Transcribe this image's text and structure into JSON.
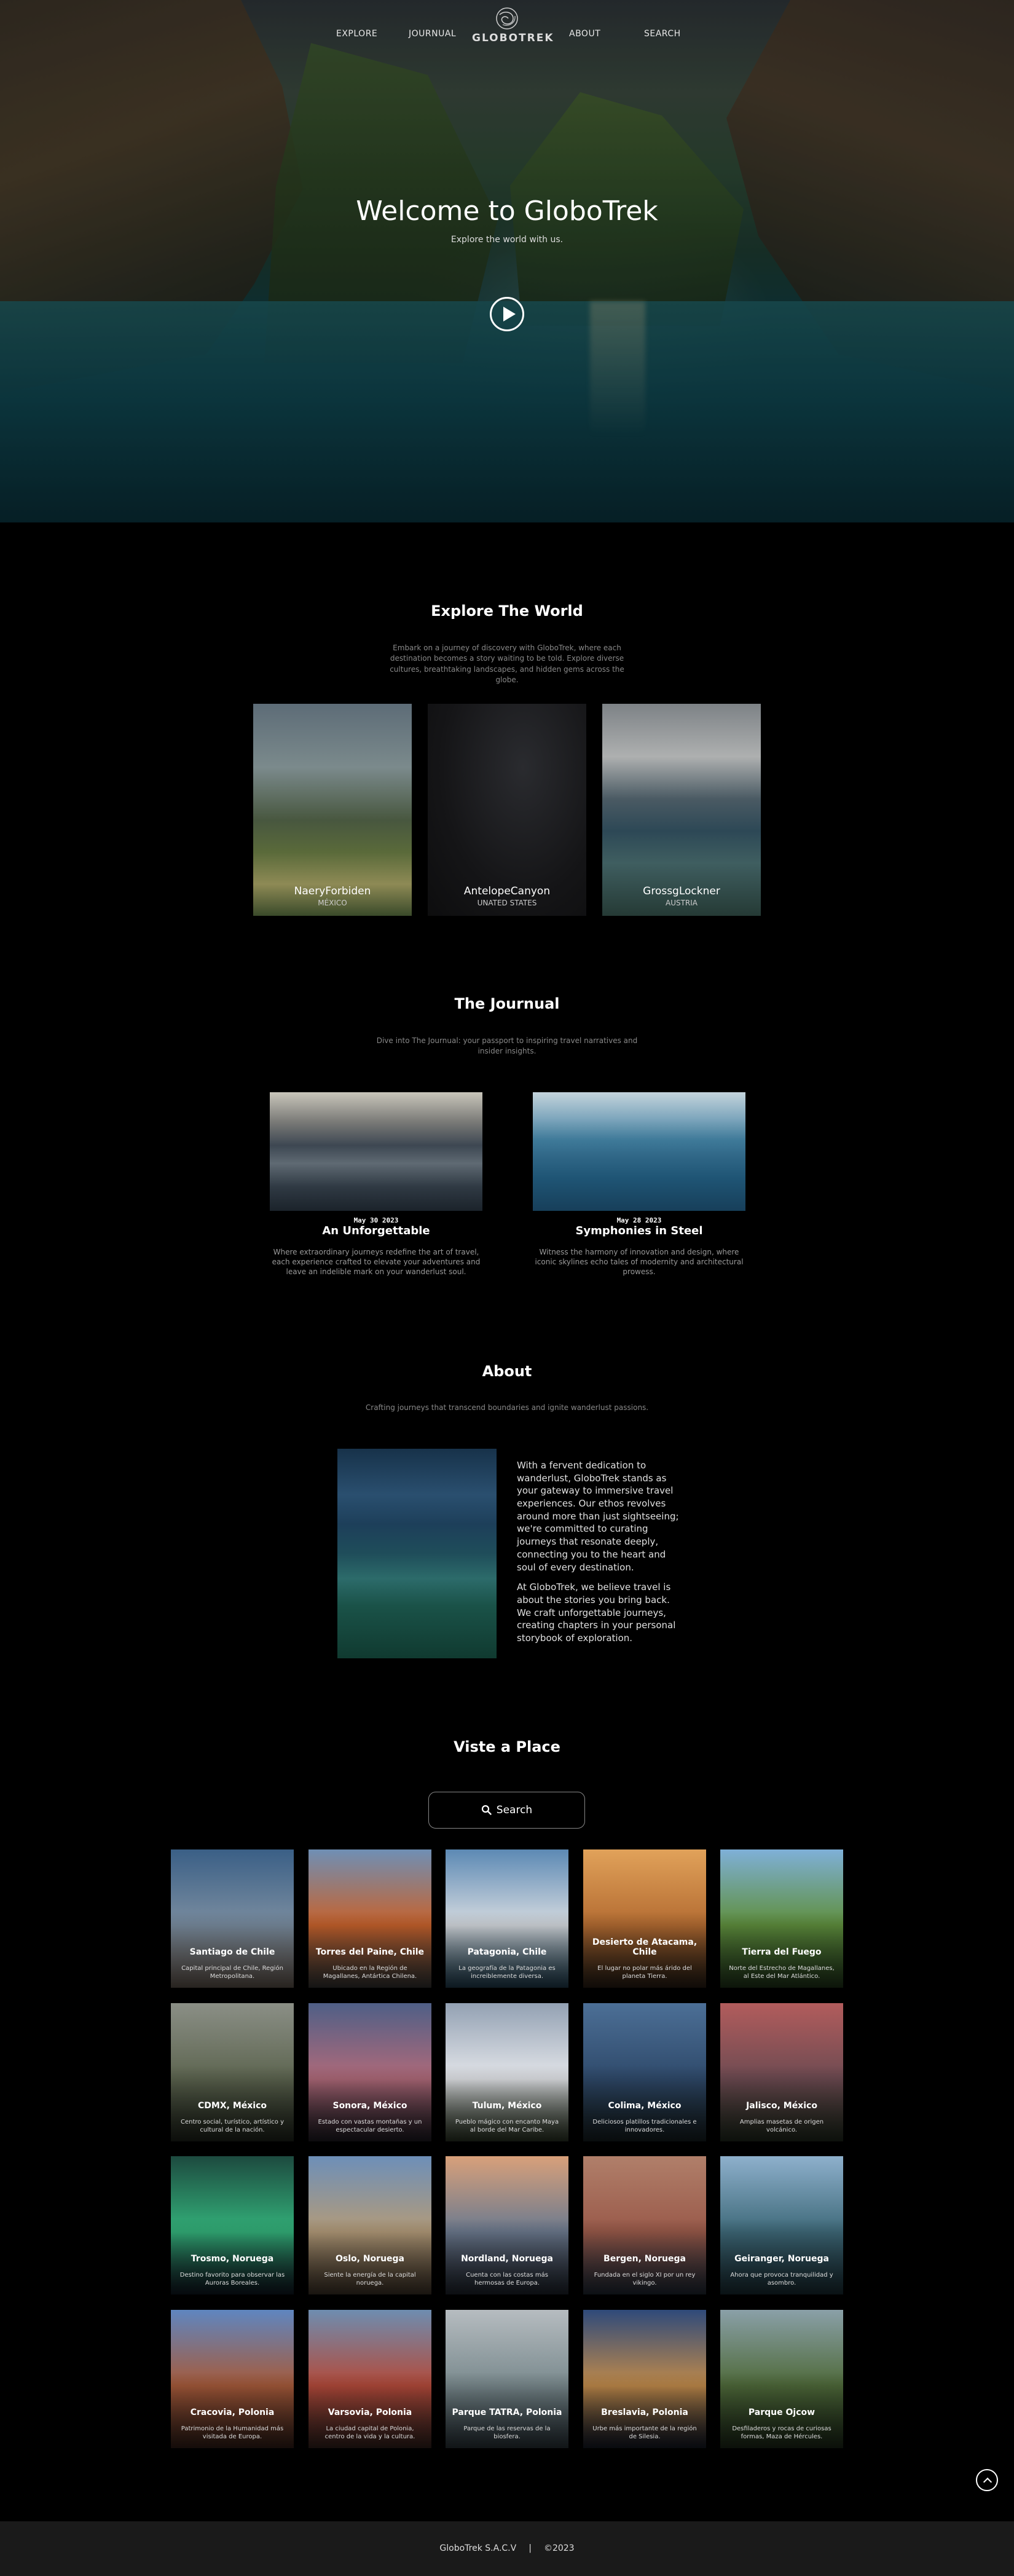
{
  "nav": {
    "links": [
      "EXPLORE",
      "JOURNUAL",
      "ABOUT",
      "SEARCH"
    ],
    "logo_text": "GLOBOTREK"
  },
  "hero": {
    "title": "Welcome to GloboTrek",
    "subtitle": "Explore the world with us."
  },
  "explore": {
    "title": "Explore The World",
    "description": "Embark on a journey of discovery with GloboTrek, where each destination becomes a story waiting to be told. Explore diverse cultures, breathtaking landscapes, and hidden gems across the globe.",
    "destinations": [
      {
        "name": "NaeryForbiden",
        "country": "MÉXICO"
      },
      {
        "name": "AntelopeCanyon",
        "country": "UNATED STATES"
      },
      {
        "name": "GrossgLockner",
        "country": "AUSTRIA"
      }
    ]
  },
  "journal": {
    "title": "The Journual",
    "description": "Dive into The Journual: your passport to inspiring travel narratives and insider insights.",
    "entries": [
      {
        "date": "May 30 2023",
        "title": "An Unforgettable",
        "text": "Where extraordinary journeys redefine the art of travel, each experience crafted to elevate your adventures and leave an indelible mark on your wanderlust soul."
      },
      {
        "date": "May 28 2023",
        "title": "Symphonies in Steel",
        "text": "Witness the harmony of innovation and design, where iconic skylines echo tales of modernity and architectural prowess."
      }
    ]
  },
  "about": {
    "title": "About",
    "subtitle": "Crafting journeys that transcend boundaries and ignite wanderlust passions.",
    "paragraphs": [
      "With a fervent dedication to wanderlust, GloboTrek stands as your gateway to immersive travel experiences. Our ethos revolves around more than just sightseeing; we're committed to curating journeys that resonate deeply, connecting you to the heart and soul of every destination.",
      "At GloboTrek, we believe travel is about the stories you bring back. We craft unforgettable journeys, creating chapters in your personal storybook of exploration."
    ]
  },
  "places": {
    "title": "Viste a Place",
    "search_label": "Search",
    "items": [
      {
        "name": "Santiago de Chile",
        "desc": "Capital principal de Chile, Región Metropolitana.",
        "colors": [
          "#3a5f86",
          "#7a8da0",
          "#8d7f73"
        ]
      },
      {
        "name": "Torres del Paine, Chile",
        "desc": "Ubicado en la Región de Magallanes, Antártica Chilena.",
        "colors": [
          "#6f8fb5",
          "#c7622c",
          "#4b4a47"
        ]
      },
      {
        "name": "Patagonia, Chile",
        "desc": "La geografía de la Patagonia es increiblemente diversa.",
        "colors": [
          "#5c89b4",
          "#d6dbe0",
          "#2f5a73"
        ]
      },
      {
        "name": "Desierto de Atacama, Chile",
        "desc": "El lugar no polar más árido del planeta Tierra.",
        "colors": [
          "#e1a25a",
          "#b46c32",
          "#3a2a1d"
        ]
      },
      {
        "name": "Tierra del Fuego",
        "desc": "Norte del Estrecho de Magallanes, al Este del Mar Atlántico.",
        "colors": [
          "#7fb0d8",
          "#5f8f3d",
          "#2e4c25"
        ]
      },
      {
        "name": "CDMX, México",
        "desc": "Centro social, turístico, artístico y cultural de la nación.",
        "colors": [
          "#8b8f86",
          "#5d6550",
          "#2c3327"
        ]
      },
      {
        "name": "Sonora, México",
        "desc": "Estado con vastas montañas y un espectacular desierto.",
        "colors": [
          "#4f5f86",
          "#b06a7a",
          "#2b2630"
        ]
      },
      {
        "name": "Tulum, México",
        "desc": "Pueblo mágico con encanto Maya al borde del Mar Caribe.",
        "colors": [
          "#93a1b3",
          "#e4e6ea",
          "#3d4a34"
        ]
      },
      {
        "name": "Colima, México",
        "desc": "Deliciosos platillos tradicionales e innovadores.",
        "colors": [
          "#4c6f96",
          "#2f4a6b",
          "#1e2a2e"
        ]
      },
      {
        "name": "Jalisco, México",
        "desc": "Amplias masetas de origen volcánico.",
        "colors": [
          "#b25c5c",
          "#6e4b52",
          "#2f3b2b"
        ]
      },
      {
        "name": "Trosmo, Noruega",
        "desc": "Destino favorito para observar las Auroras Boreales.",
        "colors": [
          "#1d4a3f",
          "#33b17a",
          "#152230"
        ]
      },
      {
        "name": "Oslo, Noruega",
        "desc": "Siente la energía de la capital noruega.",
        "colors": [
          "#6d8fb8",
          "#b39b79",
          "#5a4a3a"
        ]
      },
      {
        "name": "Nordland, Noruega",
        "desc": "Cuenta con las costas más hermosas de Europa.",
        "colors": [
          "#d8a07a",
          "#6c7a8f",
          "#2c3340"
        ]
      },
      {
        "name": "Bergen, Noruega",
        "desc": "Fundada en el siglo XI por un rey vikingo.",
        "colors": [
          "#b07f6a",
          "#9a5a4a",
          "#2e3a4a"
        ]
      },
      {
        "name": "Geiranger, Noruega",
        "desc": "Ahora que provoca tranquilidad y asombro.",
        "colors": [
          "#8eb0cc",
          "#3f6a7a",
          "#24404a"
        ]
      },
      {
        "name": "Cracovia, Polonia",
        "desc": "Patrimonio de la Humanidad más visitada de Europa.",
        "colors": [
          "#5f86c0",
          "#a65a3a",
          "#4a2c22"
        ]
      },
      {
        "name": "Varsovia, Polonia",
        "desc": "La ciudad capital de Polonia, centro de la vida y la cultura.",
        "colors": [
          "#6e8db0",
          "#b34a3a",
          "#4a2f2a"
        ]
      },
      {
        "name": "Parque TATRA, Polonia",
        "desc": "Parque de las reservas de la biosfera.",
        "colors": [
          "#b6bcc0",
          "#7a8a8e",
          "#3c4a52"
        ]
      },
      {
        "name": "Breslavia, Polonia",
        "desc": "Urbe más importante de la región de Silesia.",
        "colors": [
          "#2f4a7a",
          "#c08a4a",
          "#1e2535"
        ]
      },
      {
        "name": "Parque Ojcow",
        "desc": "Desfiladeros y rocas de curiosas formas, Maza de Hércules.",
        "colors": [
          "#8aa0a8",
          "#4f6a3a",
          "#283a22"
        ]
      }
    ]
  },
  "footer": {
    "company": "GloboTrek S.A.C.V",
    "separator": "|",
    "year": "©2023"
  }
}
